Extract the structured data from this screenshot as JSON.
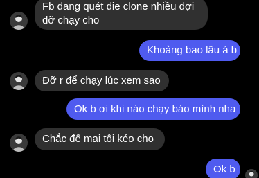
{
  "thread": {
    "messages": [
      {
        "direction": "in",
        "text": "Fb đang quét die clone nhiều đợi đỡ chạy cho",
        "line1": "Fb đang quét die clone nhiều đợi",
        "line2": "đỡ chạy cho",
        "avatar": "contact-avatar"
      },
      {
        "direction": "out",
        "text": "Khoảng bao lâu á b"
      },
      {
        "direction": "in",
        "text": "Đỡ r để chạy lúc xem sao",
        "avatar": "contact-avatar"
      },
      {
        "direction": "out",
        "text": "Ok b ơi khi nào chạy báo mình nha"
      },
      {
        "direction": "in",
        "text": "Chắc để mai tôi kéo cho",
        "avatar": "contact-avatar"
      },
      {
        "direction": "out",
        "text": "Ok b",
        "read_receipt": "seen-avatar"
      }
    ]
  },
  "colors": {
    "background": "#000000",
    "incoming_bubble": "#303030",
    "outgoing_bubble": "#4f5bef",
    "text": "#ffffff"
  }
}
